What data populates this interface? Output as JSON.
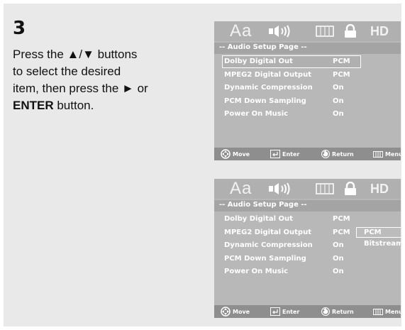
{
  "step": {
    "number": "3",
    "line1": "Press the ▲/▼ buttons",
    "line2": "to select the desired",
    "line3": "item, then press the ► or",
    "line4_bold": "ENTER",
    "line4_rest": " button."
  },
  "osd": {
    "icons": {
      "font": "Aa",
      "hd": "HD"
    },
    "header": "-- Audio Setup Page --",
    "items": [
      {
        "label": "Dolby Digital Out",
        "value": "PCM"
      },
      {
        "label": "MPEG2 Digital Output",
        "value": "PCM"
      },
      {
        "label": "Dynamic Compression",
        "value": "On"
      },
      {
        "label": "PCM Down Sampling",
        "value": "On"
      },
      {
        "label": "Power On Music",
        "value": "On"
      }
    ],
    "submenu_options": [
      "PCM",
      "Bitstream"
    ],
    "footer": {
      "move": "Move",
      "enter": "Enter",
      "return": "Return",
      "menu": "Menu"
    }
  },
  "colors": {
    "page_bg": "#e9e9e9",
    "osd_bg": "#b8b8b8",
    "osd_footer": "#8e8e8e",
    "osd_text": "#ffffff"
  }
}
